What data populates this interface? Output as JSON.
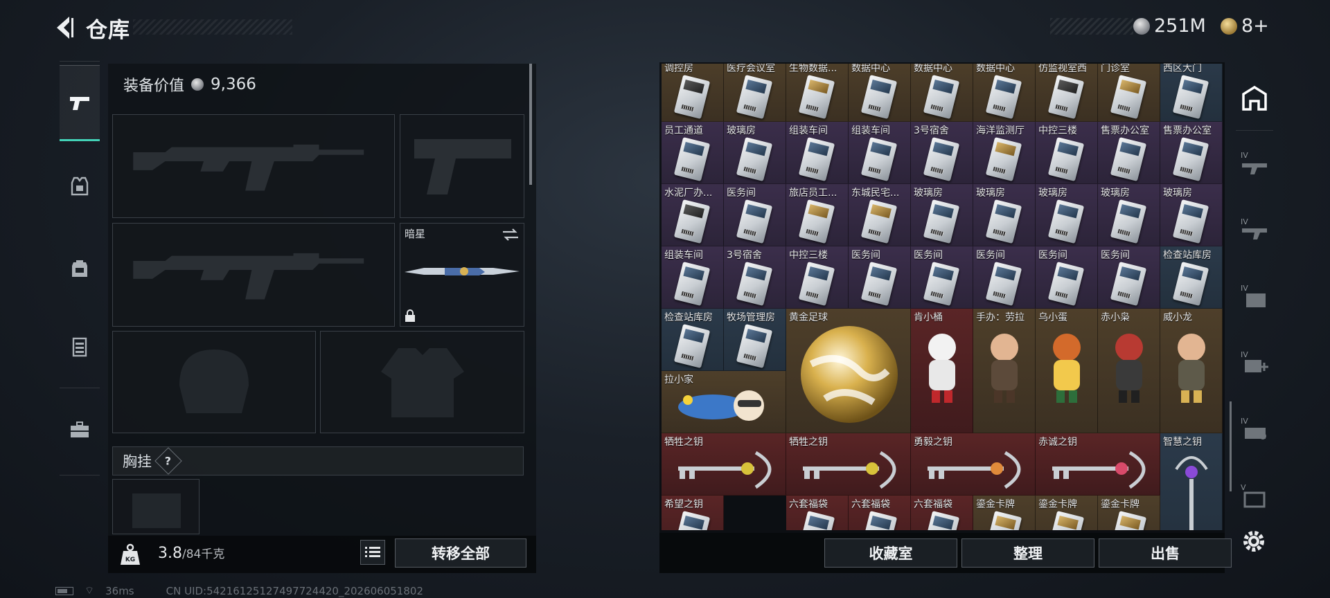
{
  "header": {
    "title": "仓库",
    "currency": {
      "silver": "251M",
      "gold": "8+"
    }
  },
  "left_nav": [
    "pistol-icon",
    "armor-icon",
    "backpack-icon",
    "chest-rig-icon",
    "case-icon"
  ],
  "equipment": {
    "value_label": "装备价值",
    "value": "9,366",
    "melee_slot_label": "暗星",
    "chest_rig_label": "胸挂",
    "chest_rig_help": "?",
    "weight_current": "3.8",
    "weight_max": "/84千克",
    "transfer_all": "转移全部"
  },
  "grid": {
    "row1": [
      "调控房",
      "医疗会议室",
      "生物数据...",
      "数据中心",
      "数据中心",
      "数据中心",
      "仿监视室西",
      "门诊室",
      "西区大门"
    ],
    "row2": [
      "员工通道",
      "玻璃房",
      "组装车间",
      "组装车间",
      "3号宿舍",
      "海洋监测厅",
      "中控三楼",
      "售票办公室",
      "售票办公室"
    ],
    "row3": [
      "水泥厂办...",
      "医务间",
      "旅店员工...",
      "东城民宅...",
      "玻璃房",
      "玻璃房",
      "玻璃房",
      "玻璃房",
      "玻璃房"
    ],
    "row4": [
      "组装车间",
      "3号宿舍",
      "中控三楼",
      "医务间",
      "医务间",
      "医务间",
      "医务间",
      "医务间",
      "检查站库房"
    ],
    "row5_cards": [
      "检查站库房",
      "牧场管理房"
    ],
    "golden_ball": "黄金足球",
    "figures": [
      "肯小桶",
      "手办：劳拉",
      "乌小蛋",
      "赤小枭",
      "威小龙"
    ],
    "lying_figure": "拉小家",
    "keys": [
      "牺牲之钥",
      "牺牲之钥",
      "勇毅之钥",
      "赤诚之钥"
    ],
    "wisdom_key": "智慧之钥",
    "row8": [
      "希望之钥",
      "",
      "六套福袋",
      "六套福袋",
      "六套福袋",
      "鎏金卡牌",
      "鎏金卡牌",
      "鎏金卡牌",
      ""
    ]
  },
  "bottom_buttons": {
    "collection": "收藏室",
    "organize": "整理",
    "sell": "出售"
  },
  "status": {
    "ping": "36ms",
    "uid": "CN UID:542161251274977244​20_202606051802"
  },
  "right_nav": [
    "map-icon",
    "tier-4-weapon-icon",
    "tier-4-weapon-icon",
    "tier-4-container-icon",
    "tier-4-medical-icon",
    "tier-4-gear-icon",
    "tier-5-icon"
  ],
  "colors": {
    "accent": "#43d2b7",
    "gold_rarity": "#4e3f2a",
    "blue_rarity": "#2b3a4a",
    "red_rarity": "#5a2526",
    "purple_rarity": "#3b2e4b"
  }
}
